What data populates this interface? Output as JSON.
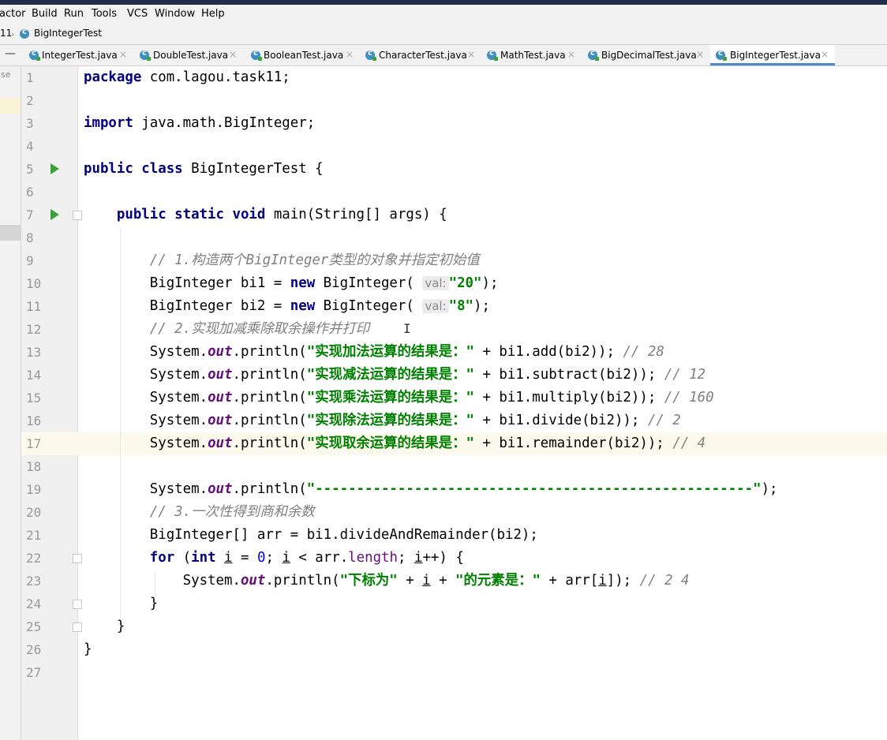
{
  "menu": [
    "actor",
    "Build",
    "Run",
    "Tools",
    "VCS",
    "Window",
    "Help"
  ],
  "nav": {
    "prefix": "11",
    "file": "BigIntegerTest"
  },
  "left_strip_label": "se",
  "tabs": [
    {
      "label": "IntegerTest.java",
      "close": "×"
    },
    {
      "label": "DoubleTest.java",
      "close": "×"
    },
    {
      "label": "BooleanTest.java",
      "close": "×"
    },
    {
      "label": "CharacterTest.java",
      "close": "×"
    },
    {
      "label": "MathTest.java",
      "close": "×"
    },
    {
      "label": "BigDecimalTest.java",
      "close": "×"
    },
    {
      "label": "BigIntegerTest.java",
      "close": "×"
    }
  ],
  "editor": {
    "current_line": 17,
    "lines": [
      [
        [
          "kw",
          "package"
        ],
        [
          "t",
          " com.lagou.task11;"
        ]
      ],
      [],
      [
        [
          "kw",
          "import"
        ],
        [
          "t",
          " java.math.BigInteger;"
        ]
      ],
      [],
      [
        [
          "kw",
          "public class"
        ],
        [
          "t",
          " BigIntegerTest {"
        ]
      ],
      [],
      [
        [
          "t",
          "    "
        ],
        [
          "kw",
          "public static void"
        ],
        [
          "t",
          " main(String[] args) {"
        ]
      ],
      [],
      [
        [
          "t",
          "        "
        ],
        [
          "cm",
          "// 1.构造两个BigInteger类型的对象并指定初始值"
        ]
      ],
      [
        [
          "t",
          "        BigInteger bi1 = "
        ],
        [
          "kw",
          "new"
        ],
        [
          "t",
          " BigInteger( "
        ],
        [
          "hint",
          "val:"
        ],
        [
          "str",
          "\"20\""
        ],
        [
          "t",
          ");"
        ]
      ],
      [
        [
          "t",
          "        BigInteger bi2 = "
        ],
        [
          "kw",
          "new"
        ],
        [
          "t",
          " BigInteger( "
        ],
        [
          "hint",
          "val:"
        ],
        [
          "str",
          "\"8\""
        ],
        [
          "t",
          ");"
        ]
      ],
      [
        [
          "t",
          "        "
        ],
        [
          "cm",
          "// 2.实现加减乘除取余操作并打印"
        ]
      ],
      [
        [
          "t",
          "        System."
        ],
        [
          "fld",
          "out"
        ],
        [
          "t",
          ".println("
        ],
        [
          "str",
          "\"实现加法运算的结果是：\""
        ],
        [
          "t",
          " + bi1.add(bi2)); "
        ],
        [
          "cm",
          "// 28"
        ]
      ],
      [
        [
          "t",
          "        System."
        ],
        [
          "fld",
          "out"
        ],
        [
          "t",
          ".println("
        ],
        [
          "str",
          "\"实现减法运算的结果是：\""
        ],
        [
          "t",
          " + bi1.subtract(bi2)); "
        ],
        [
          "cm",
          "// 12"
        ]
      ],
      [
        [
          "t",
          "        System."
        ],
        [
          "fld",
          "out"
        ],
        [
          "t",
          ".println("
        ],
        [
          "str",
          "\"实现乘法运算的结果是：\""
        ],
        [
          "t",
          " + bi1.multiply(bi2)); "
        ],
        [
          "cm",
          "// 160"
        ]
      ],
      [
        [
          "t",
          "        System."
        ],
        [
          "fld",
          "out"
        ],
        [
          "t",
          ".println("
        ],
        [
          "str",
          "\"实现除法运算的结果是：\""
        ],
        [
          "t",
          " + bi1.divide(bi2)); "
        ],
        [
          "cm",
          "// 2"
        ]
      ],
      [
        [
          "t",
          "        System."
        ],
        [
          "fld",
          "out"
        ],
        [
          "t",
          ".println("
        ],
        [
          "str",
          "\"实现取余运算的结果是：\""
        ],
        [
          "t",
          " + bi1.remainder(bi2)); "
        ],
        [
          "cm",
          "// 4"
        ]
      ],
      [],
      [
        [
          "t",
          "        System."
        ],
        [
          "fld",
          "out"
        ],
        [
          "t",
          ".println("
        ],
        [
          "str",
          "\"-----------------------------------------------------\""
        ],
        [
          "t",
          ");"
        ]
      ],
      [
        [
          "t",
          "        "
        ],
        [
          "cm",
          "// 3.一次性得到商和余数"
        ]
      ],
      [
        [
          "t",
          "        BigInteger[] arr = bi1.divideAndRemainder(bi2);"
        ]
      ],
      [
        [
          "t",
          "        "
        ],
        [
          "kw",
          "for"
        ],
        [
          "t",
          " ("
        ],
        [
          "kw",
          "int"
        ],
        [
          "t",
          " "
        ],
        [
          "ul",
          "i"
        ],
        [
          "t",
          " = "
        ],
        [
          "num",
          "0"
        ],
        [
          "t",
          "; "
        ],
        [
          "ul",
          "i"
        ],
        [
          "t",
          " < arr."
        ],
        [
          "fld2",
          "length"
        ],
        [
          "t",
          "; "
        ],
        [
          "ul",
          "i"
        ],
        [
          "t",
          "++) {"
        ]
      ],
      [
        [
          "t",
          "            System."
        ],
        [
          "fld",
          "out"
        ],
        [
          "t",
          ".println("
        ],
        [
          "str",
          "\"下标为\""
        ],
        [
          "t",
          " + "
        ],
        [
          "ul",
          "i"
        ],
        [
          "t",
          " + "
        ],
        [
          "str",
          "\"的元素是：\""
        ],
        [
          "t",
          " + arr["
        ],
        [
          "ul",
          "i"
        ],
        [
          "t",
          "]); "
        ],
        [
          "cm",
          "// 2 4"
        ]
      ],
      [
        [
          "t",
          "        }"
        ]
      ],
      [
        [
          "t",
          "    }"
        ]
      ],
      [
        [
          "t",
          "}"
        ]
      ],
      []
    ]
  }
}
